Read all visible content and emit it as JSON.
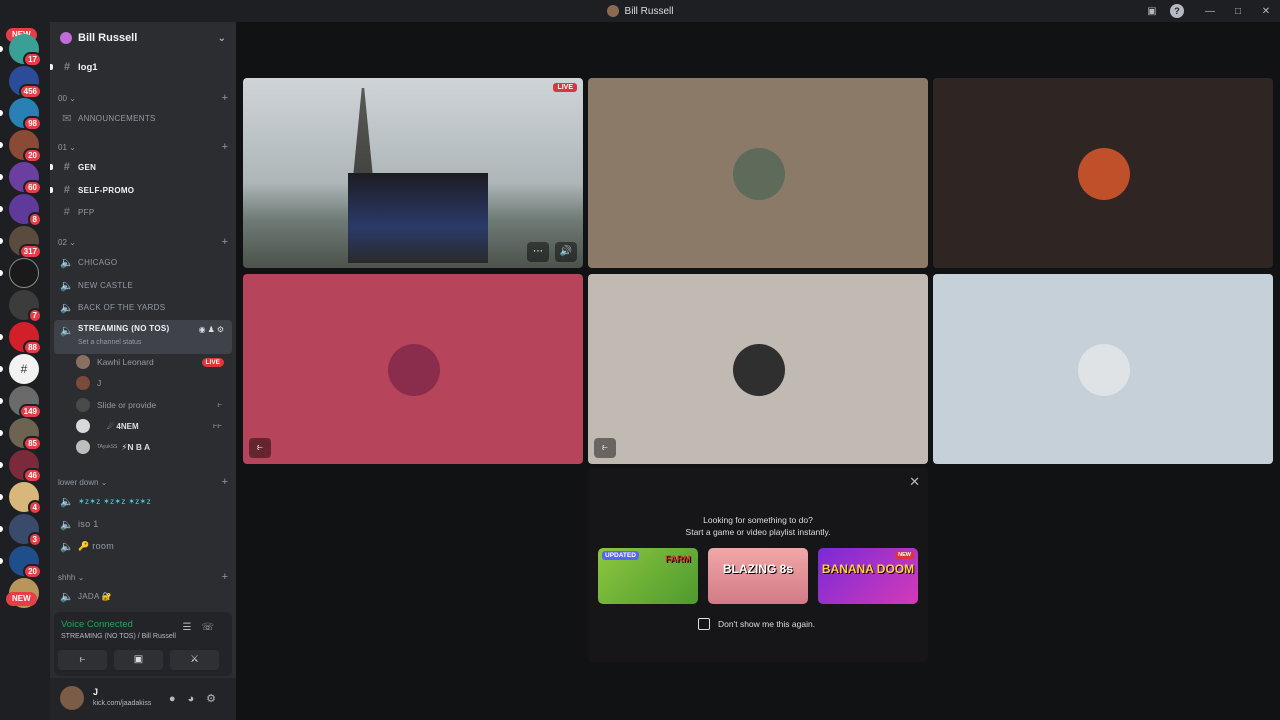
{
  "window": {
    "title": "Bill Russell"
  },
  "rail": {
    "new_top": "NEW",
    "new_bottom": "NEW",
    "badges": [
      "17",
      "456",
      "98",
      "20",
      "60",
      "8",
      "317",
      "7",
      "88",
      "149",
      "85",
      "46",
      "4",
      "3",
      "20"
    ]
  },
  "guild": {
    "name": "Bill Russell"
  },
  "channels": {
    "log1": "log1",
    "cat00": "00",
    "announcements": "ANNOUNCEMENTS",
    "cat01": "01",
    "gen": "GEN",
    "self_promo": "SELF-PROMO",
    "pfp": "PFP",
    "cat02": "02",
    "chicago": "CHICAGO",
    "new_castle": "NEW CASTLE",
    "back_of_yards": "BACK OF THE YARDS",
    "streaming": "STREAMING (NO TOS)",
    "streaming_status": "Set a channel status",
    "cat_lower": "lower down",
    "zzz": "✶z✶z ✶z✶z ✶z✶z",
    "iso": "iso 1",
    "room": "🔑 room",
    "cat_shhh": "shhh",
    "jada": "JADA 🔐"
  },
  "voice_users": [
    {
      "name": "Kawhi Leonard",
      "live": "LIVE"
    },
    {
      "name": "J"
    },
    {
      "name": "Slide or provide"
    },
    {
      "name": "☄ 4NEM"
    },
    {
      "name": "⚡N B A",
      "prefix": "TAyukSS"
    }
  ],
  "voice_panel": {
    "title": "Voice Connected",
    "subtitle": "STREAMING (NO TOS) / Bill Russell"
  },
  "user": {
    "name": "J",
    "status": "kick.com/jaadakiss"
  },
  "stage": {
    "live_label": "LIVE"
  },
  "activity": {
    "line1": "Looking for something to do?",
    "line2": "Start a game or video playlist instantly.",
    "games": [
      {
        "title": "FARM",
        "tag": "UPDATED"
      },
      {
        "title": "BLAZING 8s"
      },
      {
        "title": "BANANA DOOM",
        "tag": "NEW"
      }
    ],
    "checkbox_label": "Don't show me this again."
  }
}
